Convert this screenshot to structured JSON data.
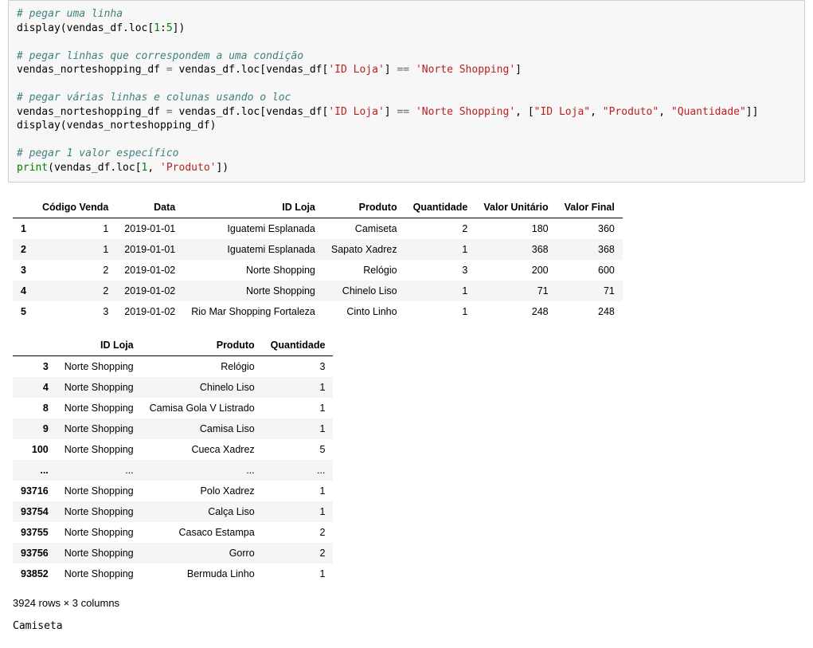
{
  "code": {
    "c1": "# pegar uma linha",
    "l1a": "display(vendas_df.loc[",
    "n1a": "1",
    "l1b": ":",
    "n1b": "5",
    "l1c": "])",
    "c2": "# pegar linhas que correspondem a uma condição",
    "l2a": "vendas_norteshopping_df ",
    "op2a": "=",
    "l2b": " vendas_df.loc[vendas_df[",
    "s2a": "'ID Loja'",
    "l2c": "] ",
    "op2b": "==",
    "l2d": " ",
    "s2b": "'Norte Shopping'",
    "l2e": "]",
    "c3": "# pegar várias linhas e colunas usando o loc",
    "l3a": "vendas_norteshopping_df ",
    "op3a": "=",
    "l3b": " vendas_df.loc[vendas_df[",
    "s3a": "'ID Loja'",
    "l3c": "] ",
    "op3b": "==",
    "l3d": " ",
    "s3b": "'Norte Shopping'",
    "l3e": ", [",
    "s3c": "\"ID Loja\"",
    "l3f": ", ",
    "s3d": "\"Produto\"",
    "l3g": ", ",
    "s3e": "\"Quantidade\"",
    "l3h": "]]",
    "l4": "display(vendas_norteshopping_df)",
    "c4": "# pegar 1 valor específico",
    "fn5": "print",
    "l5a": "(vendas_df.loc[",
    "n5a": "1",
    "l5b": ", ",
    "s5a": "'Produto'",
    "l5c": "])"
  },
  "table1": {
    "headers": [
      "Código Venda",
      "Data",
      "ID Loja",
      "Produto",
      "Quantidade",
      "Valor Unitário",
      "Valor Final"
    ],
    "rows": [
      {
        "idx": "1",
        "cells": [
          "1",
          "2019-01-01",
          "Iguatemi Esplanada",
          "Camiseta",
          "2",
          "180",
          "360"
        ]
      },
      {
        "idx": "2",
        "cells": [
          "1",
          "2019-01-01",
          "Iguatemi Esplanada",
          "Sapato Xadrez",
          "1",
          "368",
          "368"
        ]
      },
      {
        "idx": "3",
        "cells": [
          "2",
          "2019-01-02",
          "Norte Shopping",
          "Relógio",
          "3",
          "200",
          "600"
        ]
      },
      {
        "idx": "4",
        "cells": [
          "2",
          "2019-01-02",
          "Norte Shopping",
          "Chinelo Liso",
          "1",
          "71",
          "71"
        ]
      },
      {
        "idx": "5",
        "cells": [
          "3",
          "2019-01-02",
          "Rio Mar Shopping Fortaleza",
          "Cinto Linho",
          "1",
          "248",
          "248"
        ]
      }
    ]
  },
  "table2": {
    "headers": [
      "ID Loja",
      "Produto",
      "Quantidade"
    ],
    "rows": [
      {
        "idx": "3",
        "cells": [
          "Norte Shopping",
          "Relógio",
          "3"
        ]
      },
      {
        "idx": "4",
        "cells": [
          "Norte Shopping",
          "Chinelo Liso",
          "1"
        ]
      },
      {
        "idx": "8",
        "cells": [
          "Norte Shopping",
          "Camisa Gola V Listrado",
          "1"
        ]
      },
      {
        "idx": "9",
        "cells": [
          "Norte Shopping",
          "Camisa Liso",
          "1"
        ]
      },
      {
        "idx": "100",
        "cells": [
          "Norte Shopping",
          "Cueca Xadrez",
          "5"
        ]
      },
      {
        "idx": "...",
        "cells": [
          "...",
          "...",
          "..."
        ]
      },
      {
        "idx": "93716",
        "cells": [
          "Norte Shopping",
          "Polo Xadrez",
          "1"
        ]
      },
      {
        "idx": "93754",
        "cells": [
          "Norte Shopping",
          "Calça Liso",
          "1"
        ]
      },
      {
        "idx": "93755",
        "cells": [
          "Norte Shopping",
          "Casaco Estampa",
          "2"
        ]
      },
      {
        "idx": "93756",
        "cells": [
          "Norte Shopping",
          "Gorro",
          "2"
        ]
      },
      {
        "idx": "93852",
        "cells": [
          "Norte Shopping",
          "Bermuda Linho",
          "1"
        ]
      }
    ]
  },
  "summary": "3924 rows × 3 columns",
  "stdout": "Camiseta"
}
